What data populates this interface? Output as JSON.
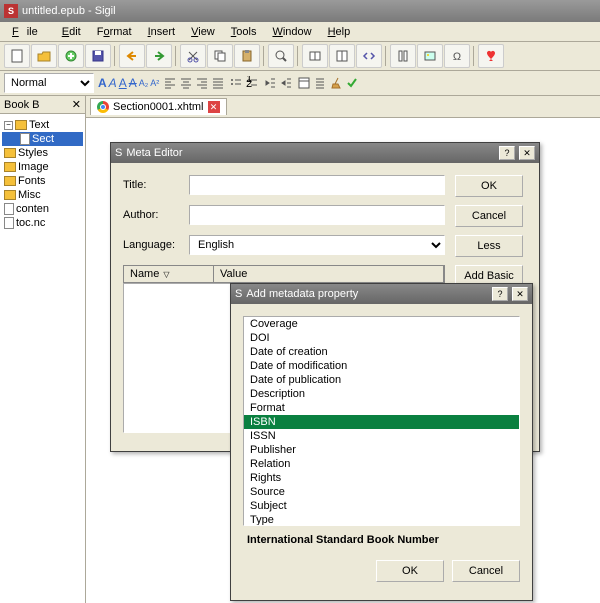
{
  "window": {
    "title": "untitled.epub - Sigil"
  },
  "menu": {
    "file": "File",
    "edit": "Edit",
    "format": "Format",
    "insert": "Insert",
    "view": "View",
    "tools": "Tools",
    "window": "Window",
    "help": "Help"
  },
  "sidebar": {
    "title": "Book B",
    "items": [
      {
        "label": "Text",
        "type": "folder",
        "expanded": true
      },
      {
        "label": "Sect",
        "type": "file",
        "selected": true
      },
      {
        "label": "Styles",
        "type": "folder"
      },
      {
        "label": "Image",
        "type": "folder"
      },
      {
        "label": "Fonts",
        "type": "folder"
      },
      {
        "label": "Misc",
        "type": "folder"
      },
      {
        "label": "conten",
        "type": "file"
      },
      {
        "label": "toc.nc",
        "type": "file"
      }
    ]
  },
  "format_select": "Normal",
  "tab": {
    "label": "Section0001.xhtml"
  },
  "meta_dialog": {
    "title": "Meta Editor",
    "title_label": "Title:",
    "author_label": "Author:",
    "language_label": "Language:",
    "language_value": "English",
    "name_col": "Name",
    "value_col": "Value",
    "ok": "OK",
    "cancel": "Cancel",
    "less": "Less",
    "add_basic": "Add Basic"
  },
  "add_dialog": {
    "title": "Add metadata property",
    "options": [
      "Coverage",
      "DOI",
      "Date of creation",
      "Date of modification",
      "Date of publication",
      "Description",
      "Format",
      "ISBN",
      "ISSN",
      "Publisher",
      "Relation",
      "Rights",
      "Source",
      "Subject",
      "Type"
    ],
    "selected_index": 7,
    "description": "International Standard Book Number",
    "ok": "OK",
    "cancel": "Cancel"
  }
}
